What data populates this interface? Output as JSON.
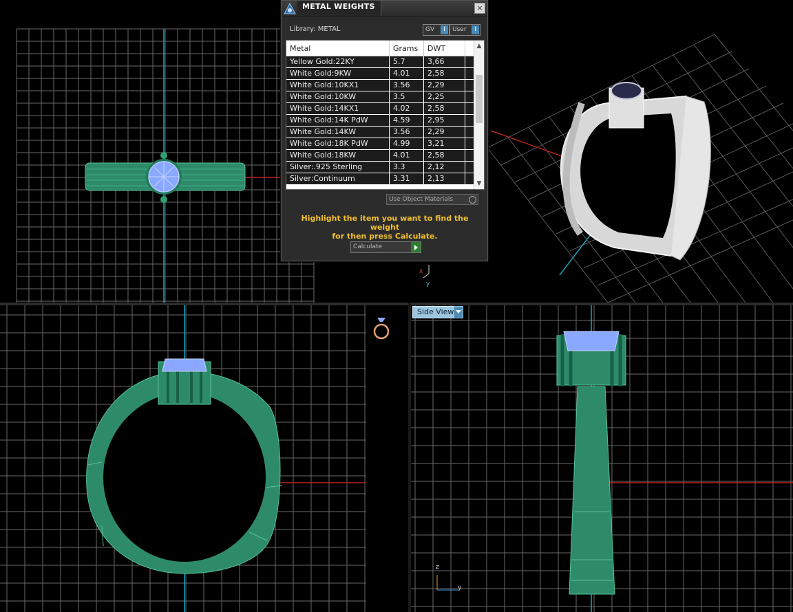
{
  "dialog": {
    "title": "METAL WEIGHTS",
    "close_glyph": "×",
    "library_label": "Library: METAL",
    "toggle_gv_label": "GV",
    "toggle_user_label": "User",
    "toggle_knob": "I",
    "columns": {
      "metal": "Metal",
      "grams": "Grams",
      "dwt": "DWT"
    },
    "rows": [
      {
        "metal": "Yellow Gold:22KY",
        "grams": "5.7",
        "dwt": "3,66"
      },
      {
        "metal": "White Gold:9KW",
        "grams": "4.01",
        "dwt": "2,58"
      },
      {
        "metal": "White Gold:10KX1",
        "grams": "3.56",
        "dwt": "2,29"
      },
      {
        "metal": "White Gold:10KW",
        "grams": "3.5",
        "dwt": "2,25"
      },
      {
        "metal": "White Gold:14KX1",
        "grams": "4.02",
        "dwt": "2,58"
      },
      {
        "metal": "White Gold:14K PdW",
        "grams": "4.59",
        "dwt": "2,95"
      },
      {
        "metal": "White Gold:14KW",
        "grams": "3.56",
        "dwt": "2,29"
      },
      {
        "metal": "White Gold:18K PdW",
        "grams": "4.99",
        "dwt": "3,21"
      },
      {
        "metal": "White Gold:18KW",
        "grams": "4.01",
        "dwt": "2,58"
      },
      {
        "metal": "Silver:.925 Sterling",
        "grams": "3.3",
        "dwt": "2,12"
      },
      {
        "metal": "Silver:Continuum",
        "grams": "3.31",
        "dwt": "2,13"
      }
    ],
    "use_object_materials_label": "Use Object Materials",
    "hint_line1": "Highlight the item you want to find the weight",
    "hint_line2": "for then press Calculate.",
    "calculate_label": "Calculate"
  },
  "viewports": {
    "side_view_label": "Side View",
    "axis_z": "z",
    "axis_y": "y",
    "axis_x": "x"
  },
  "colors": {
    "model_green": "#2e8b6a",
    "stone_blue": "#8aa8ff",
    "axis_red": "#c02020",
    "axis_cyan": "#20a0c0",
    "grid": "#6a6a6a",
    "hint_text": "#f0c030"
  },
  "icons": {
    "app_logo": "triangle-logo-icon",
    "ring_thumbnail": "ring-thumbnail-icon"
  }
}
